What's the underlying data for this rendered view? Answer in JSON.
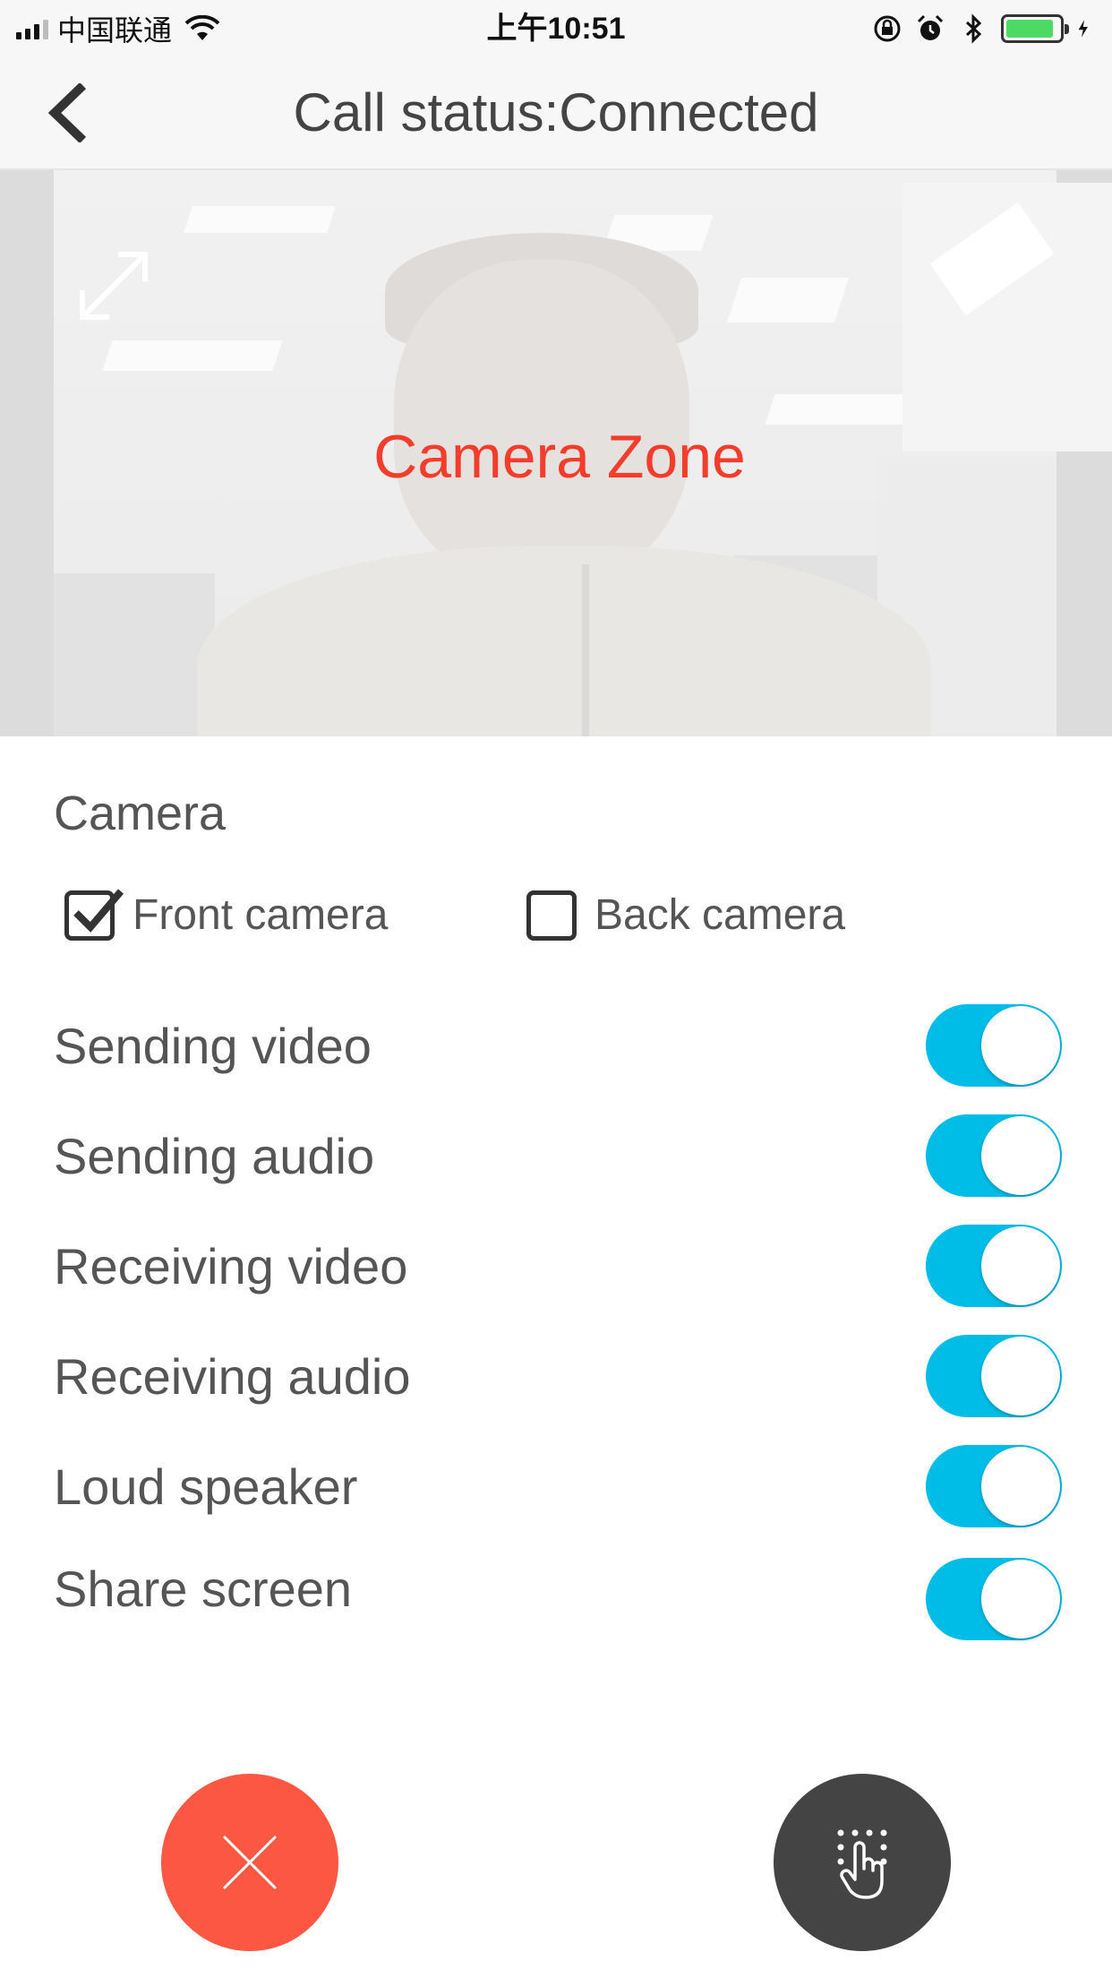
{
  "status_bar": {
    "carrier": "中国联通",
    "time": "上午10:51"
  },
  "header": {
    "title": "Call status:Connected"
  },
  "camera_zone": {
    "label": "Camera Zone"
  },
  "camera": {
    "section_title": "Camera",
    "options": [
      {
        "label": "Front camera",
        "checked": true
      },
      {
        "label": "Back camera",
        "checked": false
      }
    ]
  },
  "toggles": [
    {
      "label": "Sending video",
      "on": true
    },
    {
      "label": "Sending audio",
      "on": true
    },
    {
      "label": "Receiving video",
      "on": true
    },
    {
      "label": "Receiving audio",
      "on": true
    },
    {
      "label": "Loud speaker",
      "on": true
    },
    {
      "label": "Share screen",
      "on": true
    }
  ],
  "colors": {
    "toggle_on": "#00bde8",
    "hangup": "#fb5743",
    "dialpad": "#444444",
    "camera_label": "#f23c2c"
  },
  "icons": {
    "back": "chevron-left-icon",
    "expand": "expand-icon",
    "hangup": "close-icon",
    "dialpad": "touch-dialpad-icon"
  }
}
